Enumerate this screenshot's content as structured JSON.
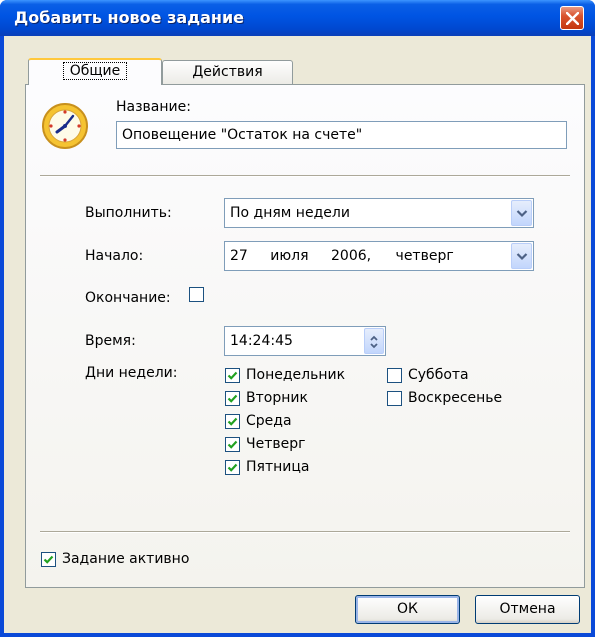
{
  "window": {
    "title": "Добавить новое задание"
  },
  "tabs": [
    {
      "label": "Общие",
      "active": true
    },
    {
      "label": "Действия",
      "active": false
    }
  ],
  "name_field": {
    "label": "Название:",
    "value": "Оповещение \"Остаток на счете\""
  },
  "schedule": {
    "run_label": "Выполнить:",
    "run_value": "По дням недели",
    "start_label": "Начало:",
    "start_day": "27",
    "start_month": "июля",
    "start_year": "2006,",
    "start_weekday": "четверг",
    "end_label": "Окончание:",
    "end_checked": false,
    "time_label": "Время:",
    "time_value": "14:24:45",
    "days_label": "Дни недели:"
  },
  "weekdays": [
    {
      "label": "Понедельник",
      "checked": true
    },
    {
      "label": "Вторник",
      "checked": true
    },
    {
      "label": "Среда",
      "checked": true
    },
    {
      "label": "Четверг",
      "checked": true
    },
    {
      "label": "Пятница",
      "checked": true
    },
    {
      "label": "Суббота",
      "checked": false
    },
    {
      "label": "Воскресенье",
      "checked": false
    }
  ],
  "task_active": {
    "label": "Задание активно",
    "checked": true
  },
  "buttons": {
    "ok": "ОК",
    "cancel": "Отмена"
  },
  "colors": {
    "titlebar": "#0054e3",
    "face": "#ece9d8",
    "check": "#21a121",
    "close": "#d9542f"
  }
}
